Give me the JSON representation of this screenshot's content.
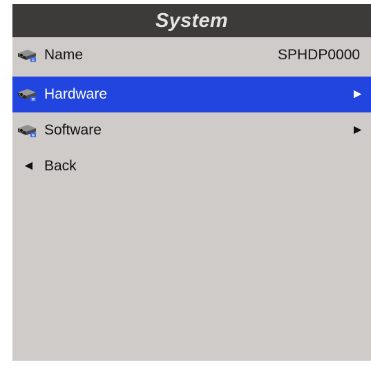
{
  "header": {
    "title": "System"
  },
  "menu": {
    "items": [
      {
        "icon": "projector-icon",
        "label": "Name",
        "value": "SPHDP0000"
      },
      {
        "icon": "projector-icon",
        "label": "Hardware",
        "arrow": "►",
        "selected": true
      },
      {
        "icon": "projector-icon",
        "label": "Software",
        "arrow": "►"
      },
      {
        "icon": "back-arrow-icon",
        "label": "Back",
        "arrow": "◄"
      }
    ]
  },
  "colors": {
    "background": "#cfcbc9",
    "title_bar": "#3d3b3a",
    "title_text": "#e4e4e4",
    "selected_row": "#2145de",
    "icon_badge": "#3f66e6"
  }
}
